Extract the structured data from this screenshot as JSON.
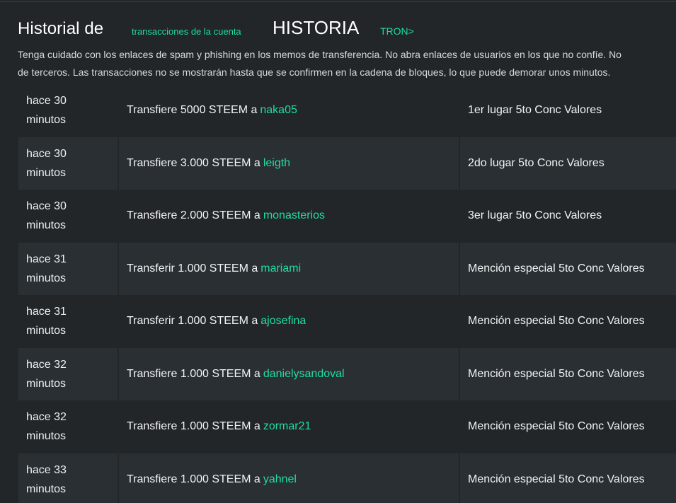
{
  "header": {
    "title": "Historial de",
    "account_link": "transacciones de la cuenta",
    "history": "HISTORIA",
    "tron_link": "TRON>"
  },
  "warning": {
    "line1": "Tenga cuidado con los enlaces de spam y phishing en los memos de transferencia. No abra enlaces de usuarios en los que no confíe. No",
    "line2": "de terceros.  Las transacciones no se mostrarán hasta que se confirmen en la cadena de bloques, lo que puede demorar unos minutos."
  },
  "transactions": [
    {
      "time1": "hace 30",
      "time2": "minutos",
      "action": "Transfiere 5000 STEEM a",
      "user": "naka05",
      "memo": "1er lugar 5to Conc Valores"
    },
    {
      "time1": "hace 30",
      "time2": "minutos",
      "action": "Transfiere 3.000 STEEM a",
      "user": "leigth",
      "memo": "2do lugar 5to Conc Valores"
    },
    {
      "time1": "hace 30",
      "time2": "minutos",
      "action": "Transfiere 2.000 STEEM a",
      "user": "monasterios",
      "memo": "3er lugar 5to Conc Valores"
    },
    {
      "time1": "hace 31",
      "time2": "minutos",
      "action": "Transferir 1.000 STEEM a",
      "user": "mariami",
      "memo": "Mención especial 5to Conc Valores"
    },
    {
      "time1": "hace 31",
      "time2": "minutos",
      "action": "Transferir 1.000 STEEM a",
      "user": "ajosefina",
      "memo": "Mención especial 5to Conc Valores"
    },
    {
      "time1": "hace 32",
      "time2": "minutos",
      "action": "Transfiere 1.000 STEEM a",
      "user": "danielysandoval",
      "memo": "Mención especial 5to Conc Valores"
    },
    {
      "time1": "hace 32",
      "time2": "minutos",
      "action": "Transfiere 1.000 STEEM a",
      "user": "zormar21",
      "memo": "Mención especial 5to Conc Valores"
    },
    {
      "time1": "hace 33",
      "time2": "minutos",
      "action": "Transfiere 1.000 STEEM a",
      "user": "yahnel",
      "memo": "Mención especial 5to Conc Valores"
    }
  ],
  "colors": {
    "background": "#222629",
    "row_alt": "#2a2f33",
    "accent": "#1fdca6",
    "text": "#eef0f1"
  }
}
